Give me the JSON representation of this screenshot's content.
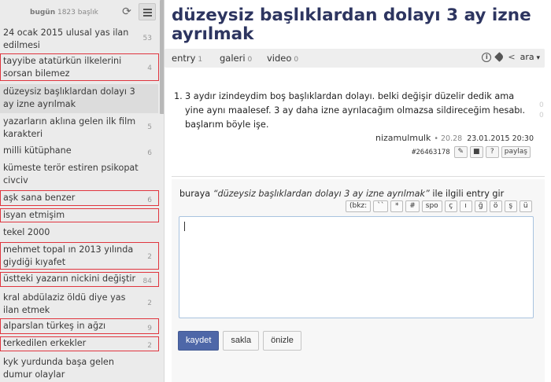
{
  "sidebar": {
    "summary_label": "bugün",
    "summary_count": "1823",
    "summary_unit": "başlık",
    "refresh_icon": "refresh-icon",
    "list_icon": "list-icon",
    "topics": [
      {
        "title": "24 ocak 2015 ulusal yas ilan edilmesi",
        "count": "53"
      },
      {
        "title": "tayyibe atatürkün ilkelerini sorsan bilemez",
        "count": "4"
      },
      {
        "title": "düzeysiz başlıklardan dolayı 3 ay izne ayrılmak",
        "count": ""
      },
      {
        "title": "yazarların aklına gelen ilk film karakteri",
        "count": "5"
      },
      {
        "title": "milli kütüphane",
        "count": "6"
      },
      {
        "title": "kümeste terör estiren psikopat civciv",
        "count": ""
      },
      {
        "title": "aşk sana benzer",
        "count": "6"
      },
      {
        "title": "isyan etmişim",
        "count": ""
      },
      {
        "title": "tekel 2000",
        "count": ""
      },
      {
        "title": "mehmet topal ın 2013 yılında giydiği kıyafet",
        "count": "2"
      },
      {
        "title": "üstteki yazarın nickini değiştir",
        "count": "84"
      },
      {
        "title": "kral abdülaziz öldü diye yas ilan etmek",
        "count": "2"
      },
      {
        "title": "alparslan türkeş in ağzı",
        "count": "9"
      },
      {
        "title": "terkedilen erkekler",
        "count": "2"
      },
      {
        "title": "kyk yurdunda başa gelen dumur olaylar",
        "count": ""
      }
    ]
  },
  "main": {
    "title": "düzeysiz başlıklardan dolayı 3 ay izne ayrılmak",
    "tabs": [
      {
        "label": "entry",
        "count": "1"
      },
      {
        "label": "galeri",
        "count": "0"
      },
      {
        "label": "video",
        "count": "0"
      }
    ],
    "info_icon": "i",
    "search_label": "ara",
    "entry": {
      "number": "1.",
      "text": "3 aydır izindeydim boş başlıklardan dolayı. belki değişir düzelir dedik ama yine aynı maalesef. 3 ay daha izne ayrılacağım olmazsa sildireceğim hesabı. başlarım böyle işe.",
      "votes": [
        "0",
        "0"
      ],
      "author": "nizamulmulk",
      "time": "20.28",
      "date": "23.01.2015 20:30",
      "id": "#26463178",
      "share_label": "paylaş",
      "question_label": "?"
    },
    "editor": {
      "prompt_prefix": "buraya",
      "prompt_quote": "“düzeysiz başlıklardan dolayı 3 ay izne ayrılmak”",
      "prompt_suffix": "ile ilgili entry gir",
      "format_buttons": [
        "(bkz:",
        "``",
        "*",
        "#",
        "spo",
        "ç",
        "ı",
        "ğ",
        "ö",
        "ş",
        "ü"
      ],
      "textarea_value": "",
      "buttons": {
        "save": "kaydet",
        "hide": "sakla",
        "preview": "önizle"
      }
    }
  },
  "colors": {
    "accent": "#4e67a8",
    "title": "#2d3560",
    "highlight": "#e0353e"
  }
}
